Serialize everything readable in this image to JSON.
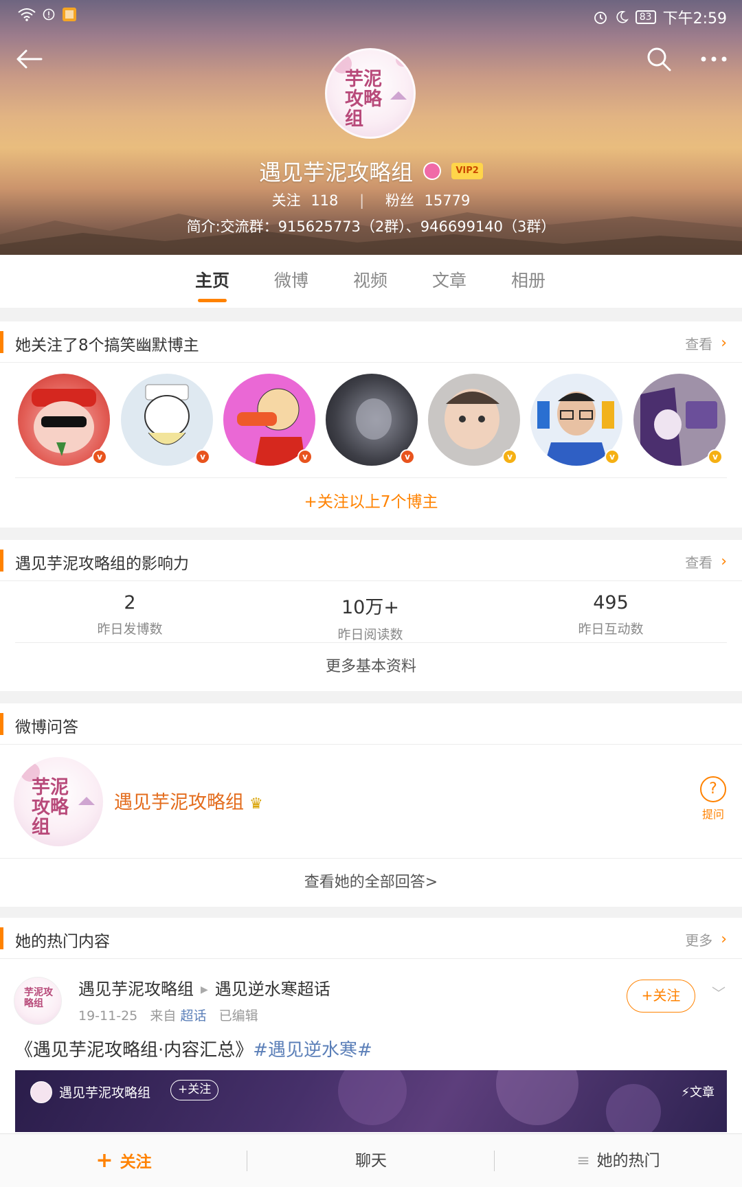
{
  "status_bar": {
    "battery": "83",
    "time": "下午2:59"
  },
  "profile": {
    "avatar_text": "芋泥攻略组",
    "name": "遇见芋泥攻略组",
    "vip_label": "VIP2",
    "following_label": "关注",
    "following_count": "118",
    "stats_separator": "|",
    "fans_label": "粉丝",
    "fans_count": "15779",
    "bio": "简介:交流群：915625773（2群）、946699140（3群）"
  },
  "tabs": [
    "主页",
    "微博",
    "视频",
    "文章",
    "相册"
  ],
  "follow_section": {
    "title": "她关注了8个搞笑幽默博主",
    "more": "查看",
    "follow_all": "+关注以上7个博主",
    "bloggers": [
      {
        "name": "santa-cartoon",
        "badge_color": "#e8541e"
      },
      {
        "name": "nurse-cartoon",
        "badge_color": "#e8541e"
      },
      {
        "name": "spray-cartoon",
        "badge_color": "#e8541e"
      },
      {
        "name": "dark-photo",
        "badge_color": "#e8541e"
      },
      {
        "name": "baby-photo",
        "badge_color": "#f5b014"
      },
      {
        "name": "man-glasses-photo",
        "badge_color": "#f5b014"
      },
      {
        "name": "anime-purple",
        "badge_color": "#f5b014"
      }
    ]
  },
  "influence": {
    "title": "遇见芋泥攻略组的影响力",
    "more": "查看",
    "metrics": [
      {
        "value": "2",
        "label": "昨日发博数"
      },
      {
        "value": "10万+",
        "label": "昨日阅读数"
      },
      {
        "value": "495",
        "label": "昨日互动数"
      }
    ],
    "more_info": "更多基本资料"
  },
  "qa": {
    "title": "微博问答",
    "name": "遇见芋泥攻略组",
    "ask_label": "提问",
    "view_all": "查看她的全部回答>"
  },
  "hot": {
    "title": "她的热门内容",
    "more": "更多",
    "post": {
      "author": "遇见芋泥攻略组",
      "supertopic": "遇见逆水寒超话",
      "date": "19-11-25",
      "from_label": "来自",
      "source": "超话",
      "edited": "已编辑",
      "follow_label": "+关注",
      "text_main": "《遇见芋泥攻略组·内容汇总》",
      "topic": "#遇见逆水寒#",
      "banner_name": "遇见芋泥攻略组",
      "banner_follow": "+关注",
      "banner_tag": "⚡文章"
    }
  },
  "bottom_bar": {
    "follow": "关注",
    "chat": "聊天",
    "hot": "她的热门"
  },
  "colors": {
    "accent": "#ff8200",
    "link": "#5b7fb8",
    "qa_name": "#e36c1d"
  }
}
